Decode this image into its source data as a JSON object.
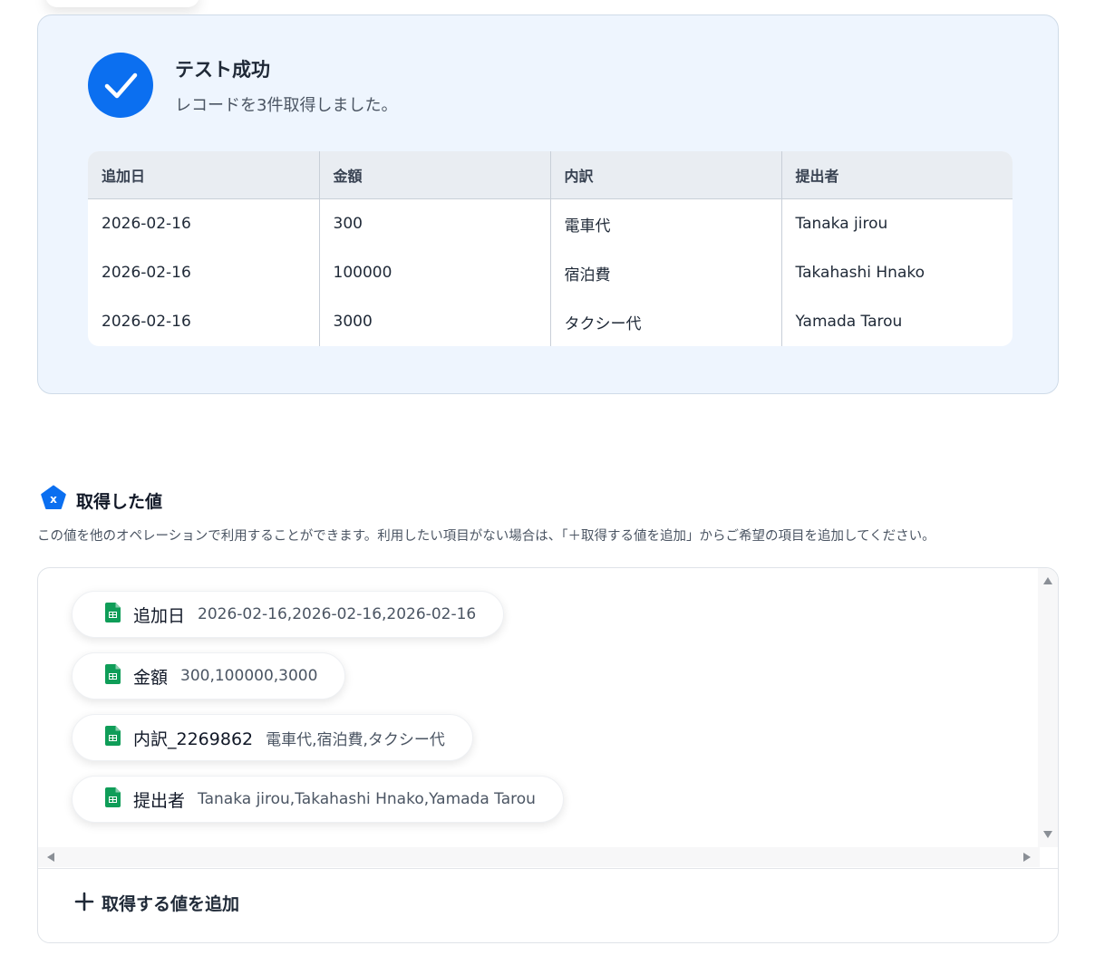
{
  "success": {
    "title": "テスト成功",
    "subtitle": "レコードを3件取得しました。"
  },
  "table": {
    "headers": [
      "追加日",
      "金額",
      "内訳",
      "提出者"
    ],
    "rows": [
      [
        "2026-02-16",
        "300",
        "電車代",
        "Tanaka jirou"
      ],
      [
        "2026-02-16",
        "100000",
        "宿泊費",
        "Takahashi Hnako"
      ],
      [
        "2026-02-16",
        "3000",
        "タクシー代",
        "Yamada Tarou"
      ]
    ]
  },
  "values": {
    "heading": "取得した値",
    "description": "この値を他のオペレーションで利用することができます。利用したい項目がない場合は、「＋取得する値を追加」からご希望の項目を追加してください。",
    "items": [
      {
        "name": "追加日",
        "value": "2026-02-16,2026-02-16,2026-02-16"
      },
      {
        "name": "金額",
        "value": "300,100000,3000"
      },
      {
        "name": "内訳_2269862",
        "value": "電車代,宿泊費,タクシー代"
      },
      {
        "name": "提出者",
        "value": "Tanaka jirou,Takahashi Hnako,Yamada Tarou"
      }
    ],
    "add_label": "取得する値を追加"
  },
  "colors": {
    "accent": "#0b6ff0",
    "sheets_green": "#0f9d58",
    "panel_bg": "#eef5fe"
  }
}
